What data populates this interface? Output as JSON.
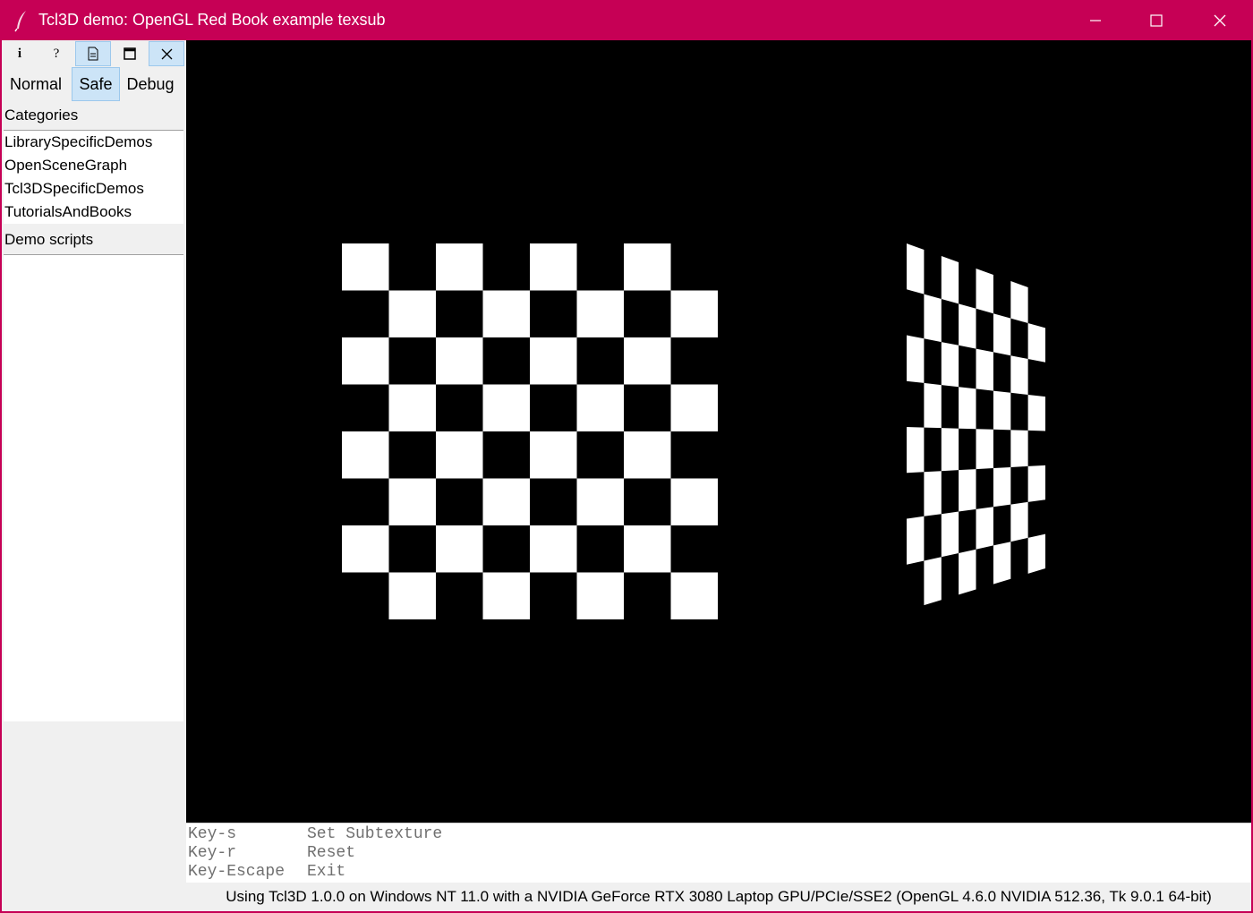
{
  "window": {
    "title": "Tcl3D demo: OpenGL Red Book example texsub",
    "app_icon": "feather-icon",
    "controls": [
      "minimize-icon",
      "maximize-icon",
      "close-icon"
    ],
    "accent": "#c60055"
  },
  "toolbar": {
    "buttons": [
      {
        "name": "info-icon",
        "glyph": "i"
      },
      {
        "name": "help-icon",
        "glyph": "?"
      },
      {
        "name": "document-icon",
        "glyph": "doc"
      },
      {
        "name": "window-icon",
        "glyph": "win"
      },
      {
        "name": "close-icon",
        "glyph": "×"
      }
    ]
  },
  "modes": {
    "normal": "Normal",
    "safe": "Safe",
    "debug": "Debug",
    "selected": "Safe"
  },
  "categories": {
    "label": "Categories",
    "items": [
      "LibrarySpecificDemos",
      "OpenSceneGraph",
      "Tcl3DSpecificDemos",
      "TutorialsAndBooks"
    ]
  },
  "demo_scripts": {
    "label": "Demo scripts",
    "items": []
  },
  "scene": {
    "background": "#000000",
    "checker_color": "#ffffff",
    "checkerboard_cells": 8
  },
  "keys": [
    {
      "key": "Key-s",
      "action": "Set Subtexture"
    },
    {
      "key": "Key-r",
      "action": "Reset"
    },
    {
      "key": "Key-Escape",
      "action": "Exit"
    }
  ],
  "status": {
    "text": "Using Tcl3D 1.0.0 on Windows NT 11.0 with a NVIDIA GeForce RTX 3080 Laptop GPU/PCIe/SSE2 (OpenGL 4.6.0 NVIDIA 512.36, Tk 9.0.1 64-bit)"
  }
}
